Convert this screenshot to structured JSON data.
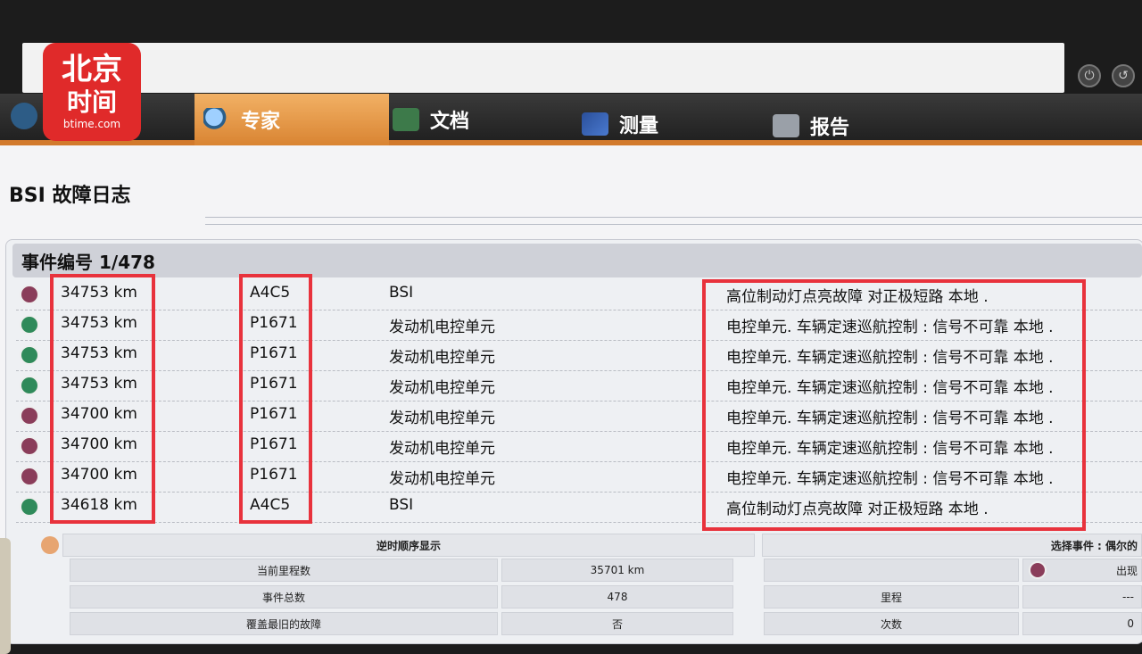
{
  "watermark": {
    "line1": "北京",
    "line2": "时间",
    "line3": "btime.com"
  },
  "nav": {
    "tabs": [
      {
        "label": "专家",
        "active": true
      },
      {
        "label": "文档",
        "active": false
      },
      {
        "label": "测量",
        "active": false
      },
      {
        "label": "报告",
        "active": false
      }
    ]
  },
  "page": {
    "title": "BSI 故障日志"
  },
  "event_header": {
    "label": "事件编号",
    "counter": "1/478"
  },
  "fault_rows": [
    {
      "km": "34753 km",
      "code": "A4C5",
      "module": "BSI",
      "description": "高位制动灯点亮故障 对正极短路 本地 .",
      "status_color": "#8a3d5a"
    },
    {
      "km": "34753 km",
      "code": "P1671",
      "module": "发动机电控单元",
      "description": "电控单元. 车辆定速巡航控制 : 信号不可靠 本地 .",
      "status_color": "#2f8a5a"
    },
    {
      "km": "34753 km",
      "code": "P1671",
      "module": "发动机电控单元",
      "description": "电控单元. 车辆定速巡航控制 : 信号不可靠 本地 .",
      "status_color": "#2f8a5a"
    },
    {
      "km": "34753 km",
      "code": "P1671",
      "module": "发动机电控单元",
      "description": "电控单元. 车辆定速巡航控制 : 信号不可靠 本地 .",
      "status_color": "#2f8a5a"
    },
    {
      "km": "34700 km",
      "code": "P1671",
      "module": "发动机电控单元",
      "description": "电控单元. 车辆定速巡航控制 : 信号不可靠 本地 .",
      "status_color": "#8a3d5a"
    },
    {
      "km": "34700 km",
      "code": "P1671",
      "module": "发动机电控单元",
      "description": "电控单元. 车辆定速巡航控制 : 信号不可靠 本地 .",
      "status_color": "#8a3d5a"
    },
    {
      "km": "34700 km",
      "code": "P1671",
      "module": "发动机电控单元",
      "description": "电控单元. 车辆定速巡航控制 : 信号不可靠 本地 .",
      "status_color": "#8a3d5a"
    },
    {
      "km": "34618 km",
      "code": "A4C5",
      "module": "BSI",
      "description": "高位制动灯点亮故障 对正极短路 本地 .",
      "status_color": "#2f8a5a"
    }
  ],
  "summary": {
    "order_label": "逆时顺序显示",
    "selected_event_label": "选择事件 : 偶尔的",
    "current_mileage_label": "当前里程数",
    "current_mileage_value": "35701 km",
    "total_events_label": "事件总数",
    "total_events_value": "478",
    "overwrite_label": "覆盖最旧的故障",
    "overwrite_value": "否",
    "appear_label": "出现",
    "mileage_label": "里程",
    "mileage_value": "---",
    "count_label": "次数",
    "count_value": "0"
  },
  "colors": {
    "accent": "#d98432",
    "highlight_box": "#e8323c",
    "watermark": "#e02a2a"
  }
}
